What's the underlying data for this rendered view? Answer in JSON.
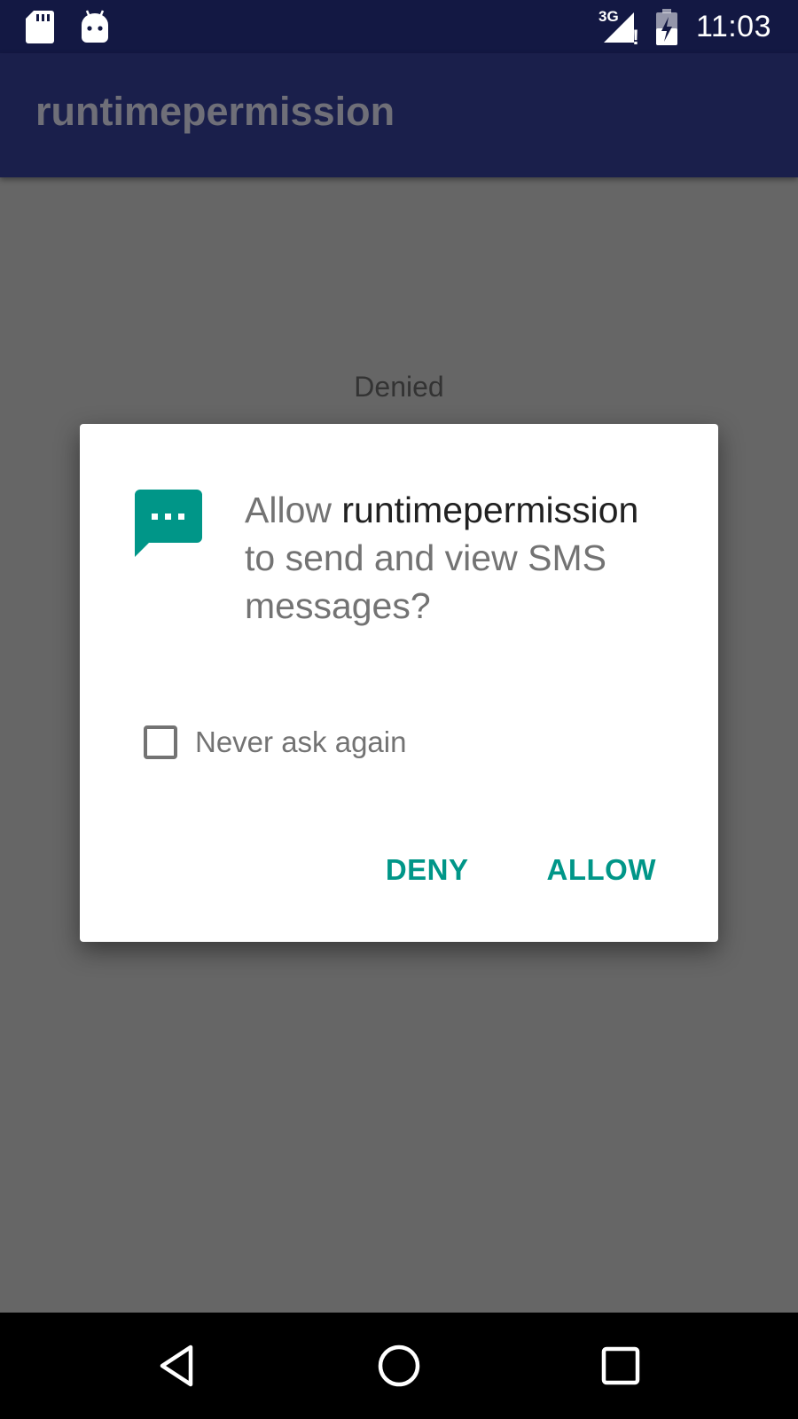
{
  "status_bar": {
    "time": "11:03",
    "network_label": "3G",
    "alert_mark": "!",
    "icons": [
      "sd-card-icon",
      "android-icon",
      "signal-3g-icon",
      "battery-charging-icon"
    ]
  },
  "app_bar": {
    "title": "runtimepermission"
  },
  "main": {
    "status_text": "Denied"
  },
  "dialog": {
    "icon": "sms-icon",
    "message_prefix": "Allow ",
    "app_name": "runtimepermission",
    "message_suffix": " to send and view SMS messages?",
    "checkbox_label": "Never ask again",
    "checkbox_checked": false,
    "deny_label": "DENY",
    "allow_label": "ALLOW"
  },
  "nav_bar": {
    "icons": [
      "back-icon",
      "home-icon",
      "recents-icon"
    ]
  },
  "colors": {
    "status_bar": "#131843",
    "app_bar": "#1a1f4b",
    "scrim": "#666666",
    "accent": "#009688"
  }
}
